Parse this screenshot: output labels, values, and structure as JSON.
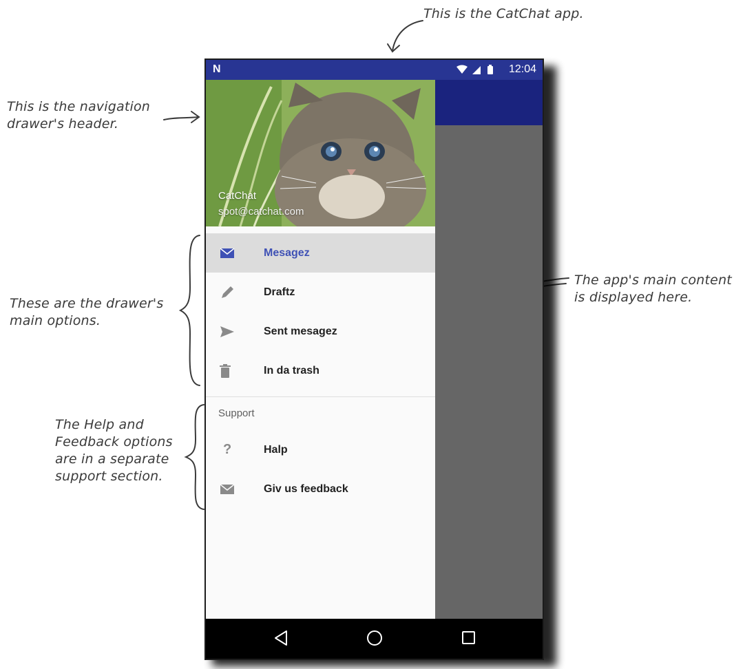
{
  "annotations": {
    "app": "This is the CatChat app.",
    "header": [
      "This is the navigation",
      "drawer's header."
    ],
    "main_options": [
      "These are the drawer's",
      "main options."
    ],
    "support_section": [
      "The Help and",
      "Feedback options",
      "are in a separate",
      "support section."
    ],
    "main_content": [
      "The app's main content",
      "is displayed here."
    ]
  },
  "status_bar": {
    "logo": "N",
    "time": "12:04"
  },
  "drawer": {
    "header": {
      "title": "CatChat",
      "email": "spot@catchat.com"
    },
    "items": [
      {
        "label": "Mesagez",
        "icon": "email-icon",
        "selected": true
      },
      {
        "label": "Draftz",
        "icon": "pencil-icon",
        "selected": false
      },
      {
        "label": "Sent mesagez",
        "icon": "send-icon",
        "selected": false
      },
      {
        "label": "In da trash",
        "icon": "trash-icon",
        "selected": false
      }
    ],
    "support": {
      "label": "Support",
      "items": [
        {
          "label": "Halp",
          "icon": "help-icon"
        },
        {
          "label": "Giv us feedback",
          "icon": "feedback-icon"
        }
      ]
    }
  },
  "colors": {
    "status_bar": "#283593",
    "toolbar": "#1a237e",
    "accent": "#3f51b5",
    "scrim": "#666666"
  }
}
